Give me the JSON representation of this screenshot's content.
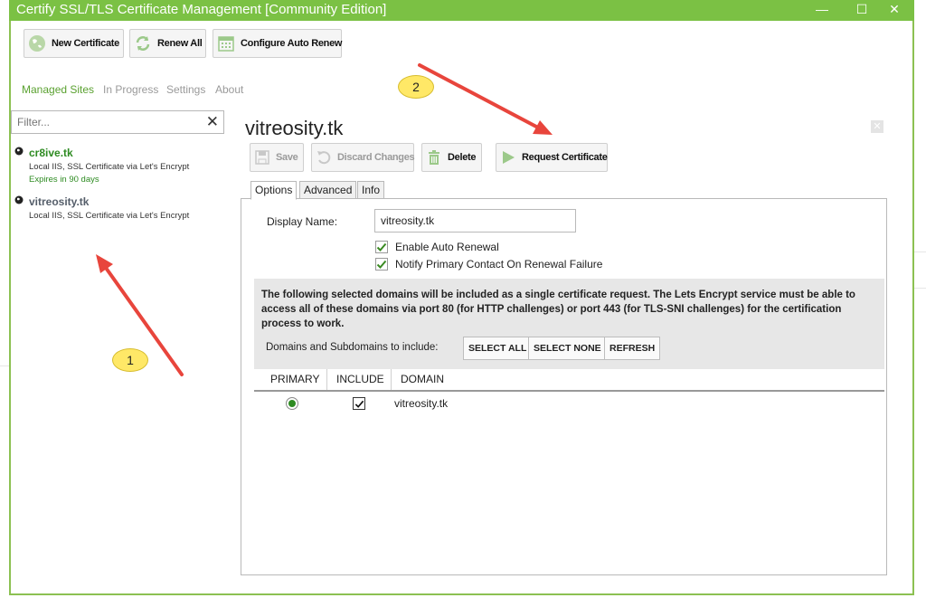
{
  "window": {
    "title": "Certify SSL/TLS Certificate Management [Community Edition]",
    "accent_color": "#7bc144",
    "controls": {
      "minimize": "—",
      "maximize": "☐",
      "close": "✕"
    }
  },
  "toolbar": {
    "new_certificate": "New Certificate",
    "renew_all": "Renew All",
    "configure_auto_renew": "Configure Auto Renew"
  },
  "nav": {
    "tabs": [
      {
        "label": "Managed Sites",
        "active": true
      },
      {
        "label": "In Progress",
        "active": false
      },
      {
        "label": "Settings",
        "active": false
      },
      {
        "label": "About",
        "active": false
      }
    ]
  },
  "filter": {
    "placeholder": "Filter...",
    "clear_icon": "close-icon"
  },
  "sites": [
    {
      "name": "cr8ive.tk",
      "description": "Local IIS, SSL Certificate via Let's Encrypt",
      "expires": "Expires in 90 days"
    },
    {
      "name": "vitreosity.tk",
      "description": "Local IIS, SSL Certificate via Let's Encrypt"
    }
  ],
  "detail": {
    "title": "vitreosity.tk",
    "actions": {
      "save": "Save",
      "discard": "Discard Changes",
      "delete": "Delete",
      "request": "Request Certificate"
    },
    "tabs": [
      {
        "label": "Options",
        "active": true
      },
      {
        "label": "Advanced",
        "active": false
      },
      {
        "label": "Info",
        "active": false
      }
    ],
    "display_name_label": "Display Name:",
    "display_name_value": "vitreosity.tk",
    "enable_auto_renewal": {
      "label": "Enable Auto Renewal",
      "checked": true
    },
    "notify_contact": {
      "label": "Notify Primary Contact On Renewal Failure",
      "checked": true
    },
    "info_text": "The following selected domains will be included as a single certificate request. The Lets Encrypt service must be able to access all of these domains via port 80 (for HTTP challenges) or port 443 (for TLS-SNI challenges) for the certification process to work.",
    "domains_label": "Domains and Subdomains to include:",
    "select_all": "SELECT ALL",
    "select_none": "SELECT NONE",
    "refresh": "REFRESH",
    "grid": {
      "headers": [
        "PRIMARY",
        "INCLUDE",
        "DOMAIN"
      ],
      "rows": [
        {
          "primary": true,
          "include": true,
          "domain": "vitreosity.tk"
        }
      ]
    }
  },
  "callouts": {
    "one": "1",
    "two": "2"
  },
  "arrow_color": "#e8453c"
}
